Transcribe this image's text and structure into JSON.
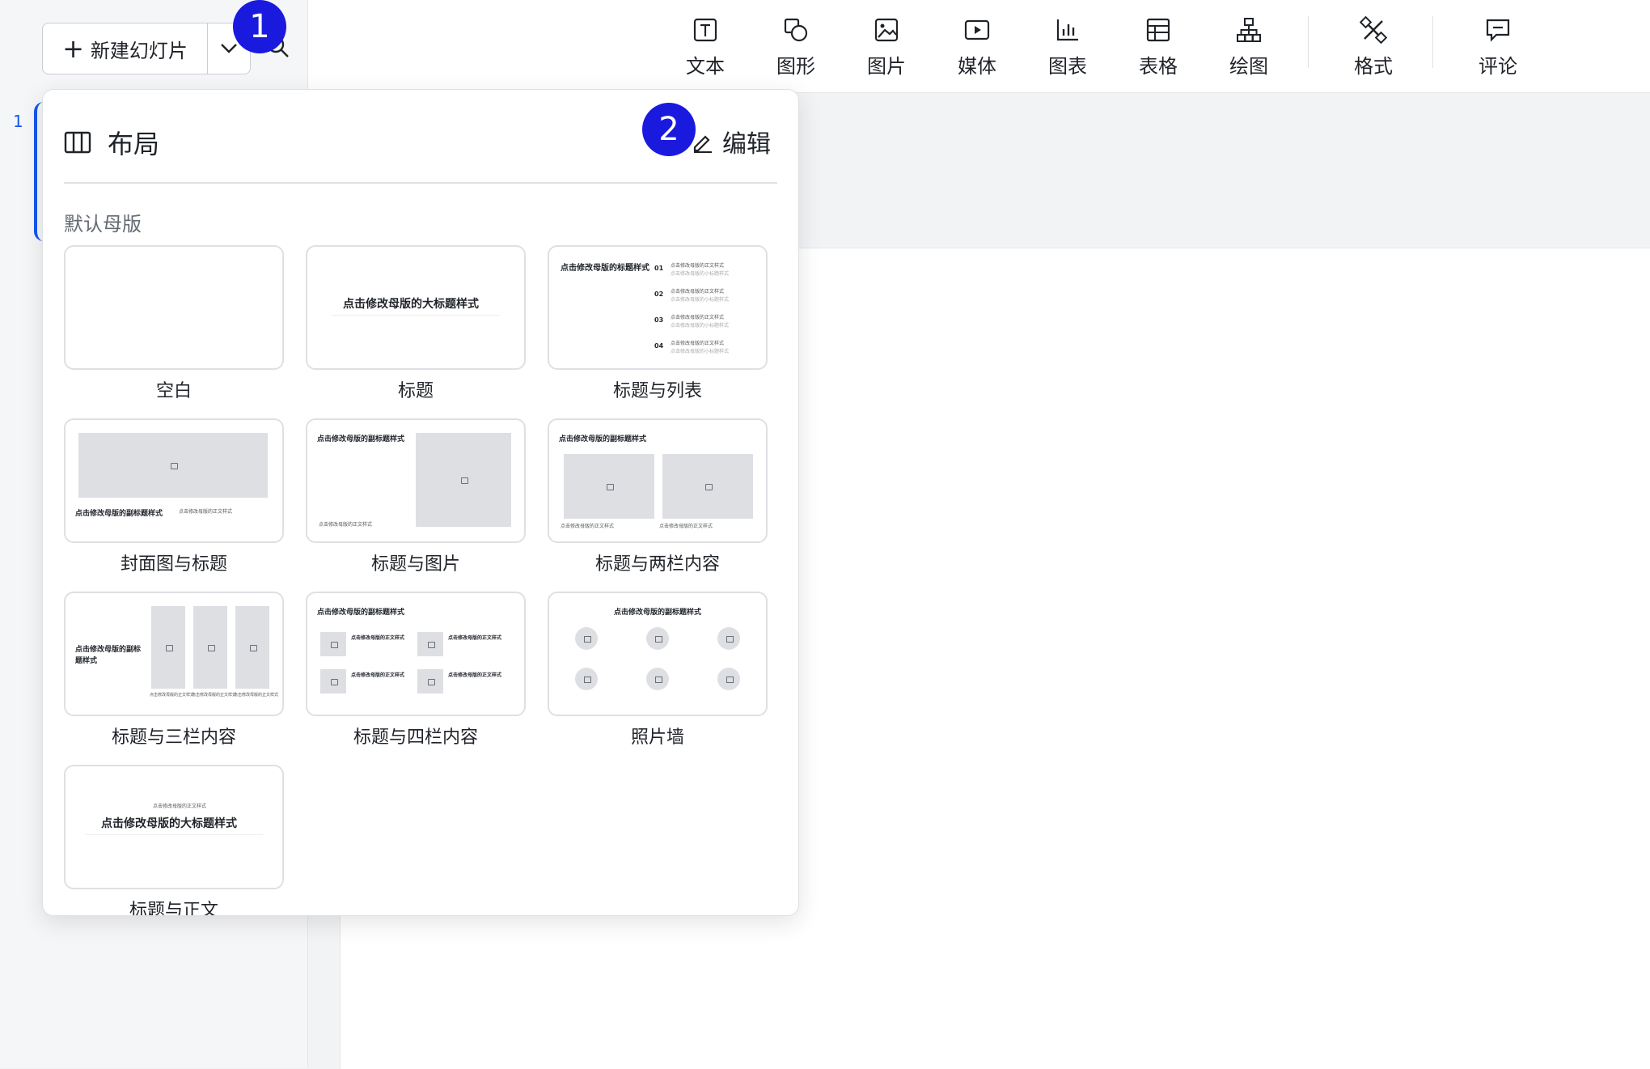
{
  "sidebar": {
    "new_slide_label": "新建幻灯片",
    "slide_number": "1"
  },
  "toolbar": {
    "items": [
      {
        "label": "文本",
        "icon": "text-icon"
      },
      {
        "label": "图形",
        "icon": "shape-icon"
      },
      {
        "label": "图片",
        "icon": "image-icon"
      },
      {
        "label": "媒体",
        "icon": "media-icon"
      },
      {
        "label": "图表",
        "icon": "chart-icon"
      },
      {
        "label": "表格",
        "icon": "table-icon"
      },
      {
        "label": "绘图",
        "icon": "diagram-icon"
      },
      {
        "label": "格式",
        "icon": "format-icon"
      },
      {
        "label": "评论",
        "icon": "comment-icon"
      }
    ]
  },
  "badges": {
    "one": "1",
    "two": "2"
  },
  "layout_panel": {
    "title": "布局",
    "edit_label": "编辑",
    "group_label": "默认母版",
    "thumb_text": {
      "big_title": "点击修改母版的大标题样式",
      "title_style": "点击修改母版的标题样式",
      "subtitle_style": "点击修改母版的副标题样式",
      "subtitle_style_a": "点击修改母版的副标",
      "subtitle_style_b": "题样式",
      "body_style": "点击修改母版的正文样式",
      "num1": "01",
      "num2": "02",
      "num3": "03",
      "num4": "04",
      "list_line1": "点击修改母版的正文样式",
      "list_line2": "点击修改母版的小标题样式"
    },
    "layouts": [
      {
        "name": "空白"
      },
      {
        "name": "标题"
      },
      {
        "name": "标题与列表"
      },
      {
        "name": "封面图与标题"
      },
      {
        "name": "标题与图片"
      },
      {
        "name": "标题与两栏内容"
      },
      {
        "name": "标题与三栏内容"
      },
      {
        "name": "标题与四栏内容"
      },
      {
        "name": "照片墙"
      },
      {
        "name": "标题与正文"
      }
    ]
  }
}
